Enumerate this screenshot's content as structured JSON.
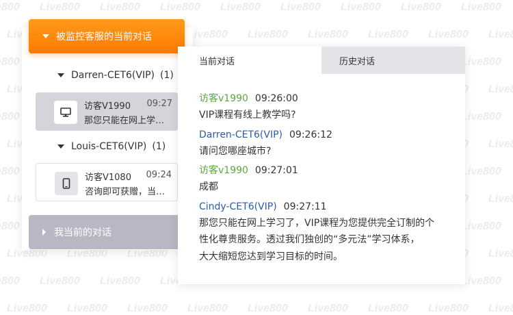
{
  "watermark": "Live800",
  "sidebar": {
    "monitored_header": "被监控客服的当前对话",
    "my_header": "我当前的对话",
    "groups": [
      {
        "agent": "Darren-CET6(VIP)",
        "count": "(1)",
        "conversation": {
          "visitor": "访客V1990",
          "time": "09:27",
          "preview": "那您只能在网上学习了，VIP课程为您提供",
          "icon": "desktop-icon"
        }
      },
      {
        "agent": "Louis-CET6(VIP)",
        "count": "(1)",
        "conversation": {
          "visitor": "访客V1080",
          "time": "09:24",
          "preview": "咨询即可获赠，当天报名",
          "icon": "mobile-icon"
        }
      }
    ]
  },
  "tabs": {
    "current": "当前对话",
    "history": "历史对话"
  },
  "messages": [
    {
      "sender": "访客v1990",
      "role": "visitor",
      "time": "09:26:00",
      "text": "VIP课程有线上教学吗?"
    },
    {
      "sender": "Darren-CET6(VIP)",
      "role": "agent",
      "time": "09:26:12",
      "text": "请问您哪座城市?"
    },
    {
      "sender": "访客v1990",
      "role": "visitor",
      "time": "09:27:01",
      "text": "成都"
    },
    {
      "sender": "Cindy-CET6(VIP)",
      "role": "agent",
      "time": "09:27:11",
      "lines": [
        "那您只能在网上学习了，VIP课程为您提供完全订制的个",
        "性化尊贵服务。透过我们独创的“多元法”学习体系，",
        "大大缩短您达到学习目标的时间。"
      ]
    }
  ],
  "colors": {
    "accent": "#ff8a00",
    "visitor_name": "#5aa83d",
    "agent_name": "#2a5caa",
    "inactive_header": "#b7b8c3",
    "active_card": "#d4d5db"
  }
}
